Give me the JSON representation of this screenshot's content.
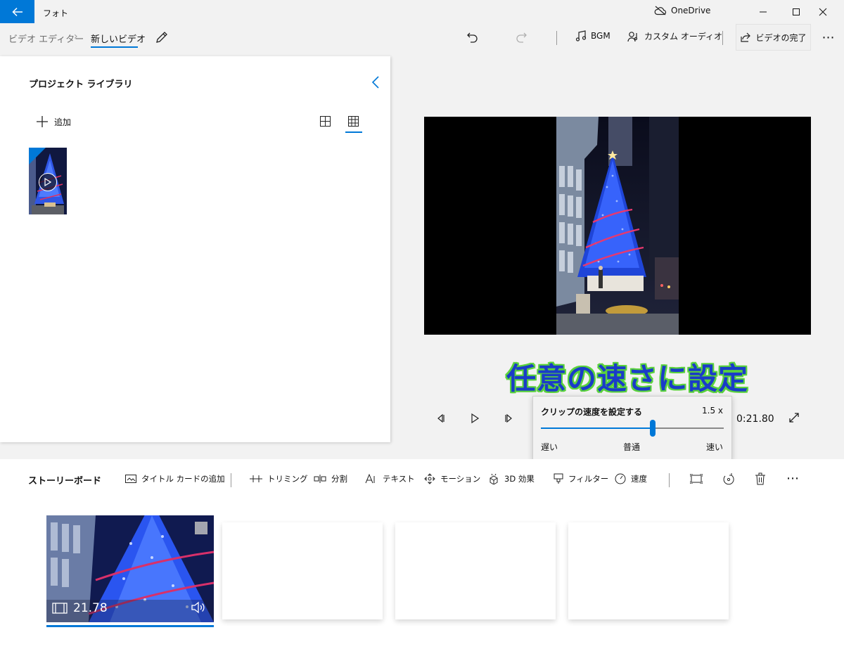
{
  "titlebar": {
    "app_title": "フォト",
    "onedrive_label": "OneDrive"
  },
  "commandbar": {
    "breadcrumb_root": "ビデオ エディター",
    "breadcrumb_current": "新しいビデオ",
    "bgm_label": "BGM",
    "custom_audio_label": "カスタム オーディオ",
    "finish_label": "ビデオの完了",
    "more_label": "⋯"
  },
  "library": {
    "title": "プロジェクト ライブラリ",
    "add_label": "追加"
  },
  "player": {
    "timecode": "0:21.80"
  },
  "caption": "任意の速さに設定",
  "speed": {
    "title": "クリップの速度を設定する",
    "value_label": "1.5 x",
    "slow_label": "遅い",
    "normal_label": "普通",
    "fast_label": "速い",
    "level": 0.61
  },
  "storyboard": {
    "title": "ストーリーボード",
    "tools": {
      "title_card": "タイトル カードの追加",
      "trim": "トリミング",
      "split": "分割",
      "text": "テキスト",
      "motion": "モーション",
      "effects3d": "3D 効果",
      "filters": "フィルター",
      "speed": "速度"
    },
    "more_label": "⋯",
    "clip": {
      "duration": "21.78"
    }
  },
  "colors": {
    "accent": "#0078d7",
    "caption_fill": "#1a3cc8",
    "caption_outline": "#5ad23c"
  }
}
